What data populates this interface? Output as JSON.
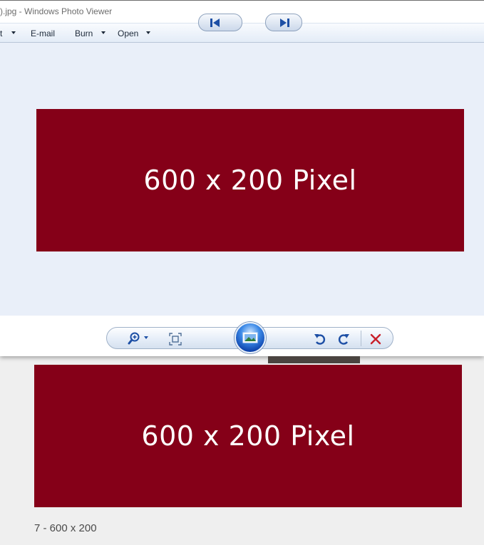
{
  "window": {
    "title": ").jpg - Windows Photo Viewer"
  },
  "menubar": {
    "items": [
      {
        "label": "t"
      },
      {
        "label": "E-mail"
      },
      {
        "label": "Burn"
      },
      {
        "label": "Open"
      }
    ]
  },
  "photo": {
    "text": "600 x 200 Pixel",
    "color": "#850018"
  },
  "controls": {
    "zoom": "zoom-icon",
    "fit": "actual-size-icon",
    "previous": "previous-icon",
    "slideshow": "slideshow-icon",
    "next": "next-icon",
    "rotate_ccw": "rotate-counterclockwise-icon",
    "rotate_cw": "rotate-clockwise-icon",
    "delete": "delete-icon"
  },
  "background_page": {
    "photo_text": "600 x 200 Pixel",
    "caption": "7 - 600 x 200"
  }
}
